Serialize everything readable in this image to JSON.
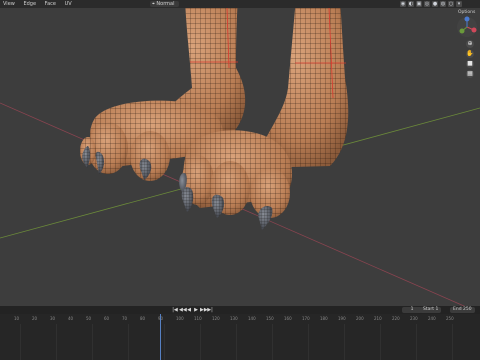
{
  "header": {
    "menus": [
      "View",
      "Edge",
      "Face",
      "UV"
    ],
    "transform_orientation": "Normal",
    "options_label": "Options"
  },
  "viewport": {
    "axis_x_color": "#a04a55",
    "axis_y_color": "#6b8a3a",
    "skin_color": "#c98e63",
    "claw_color": "#555a63",
    "seam_color": "#d83a2e"
  },
  "nav_icons": [
    "zoom-icon",
    "pan-icon",
    "camera-icon",
    "grid-icon"
  ],
  "timeline": {
    "playback_glyphs": [
      "|◀",
      "◀◀",
      "◀",
      "▶",
      "▶▶",
      "▶|"
    ],
    "current_frame": "1",
    "start_label": "Start",
    "start_value": "1",
    "end_label": "End",
    "end_value": "250",
    "ruler_ticks": [
      "10",
      "20",
      "30",
      "40",
      "50",
      "60",
      "70",
      "80",
      "90",
      "100",
      "110",
      "120",
      "130",
      "140",
      "150",
      "160",
      "170",
      "180",
      "190",
      "200",
      "210",
      "220",
      "230",
      "240",
      "250"
    ]
  }
}
